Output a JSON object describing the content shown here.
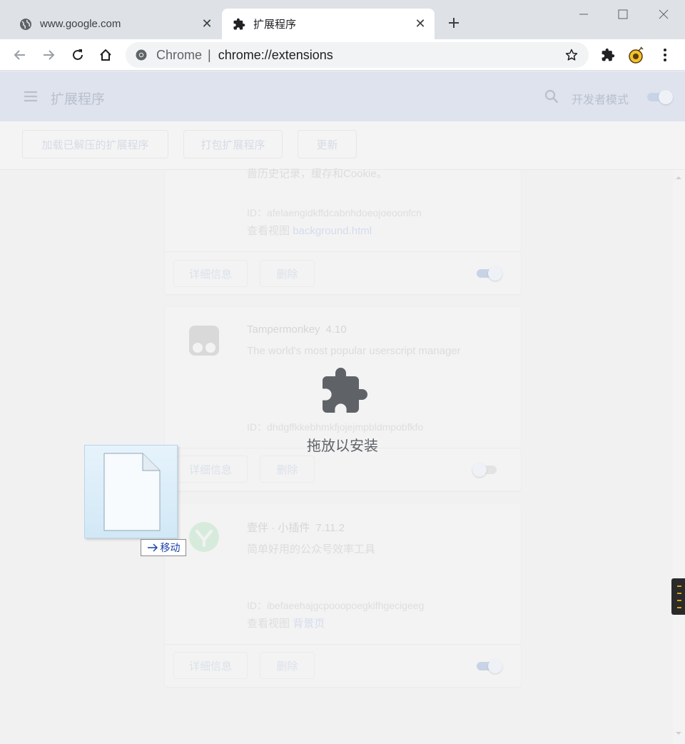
{
  "tabs": [
    {
      "title": "www.google.com",
      "favicon": "globe-icon",
      "active": false
    },
    {
      "title": "扩展程序",
      "favicon": "puzzle-icon",
      "active": true
    }
  ],
  "omnibox": {
    "scheme": "Chrome",
    "separator": "|",
    "url": "chrome://extensions"
  },
  "header": {
    "title": "扩展程序",
    "dev_mode_label": "开发者模式",
    "dev_mode_on": true
  },
  "toolbar_buttons": {
    "load_unpacked": "加载已解压的扩展程序",
    "pack": "打包扩展程序",
    "update": "更新"
  },
  "cards": [
    {
      "desc_tail": "啬历史记录，缓存和Cookie。",
      "id_label": "ID：",
      "id": "afelaengidkffdcabnhdoeojoeoonfcn",
      "views_label": "查看视图",
      "view_link": "background.html",
      "details_label": "详细信息",
      "remove_label": "删除",
      "enabled": true
    },
    {
      "name": "Tampermonkey",
      "version": "4.10",
      "desc": "The world's most popular userscript manager",
      "id_label": "ID：",
      "id": "dhdgffkkebhmkfjojejmpbldmpobfkfo",
      "details_label": "详细信息",
      "remove_label": "删除",
      "enabled": false
    },
    {
      "name": "壹伴 · 小插件",
      "version": "7.11.2",
      "desc": "简单好用的公众号效率工具",
      "id_label": "ID：",
      "id": "ibefaeehajgcpooopoegkifhgecigeeg",
      "views_label": "查看视图",
      "view_link": "背景页",
      "details_label": "详细信息",
      "remove_label": "删除",
      "enabled": true
    }
  ],
  "drop_overlay": {
    "label": "拖放以安装",
    "icon": "puzzle-icon"
  },
  "drag_ghost": {
    "badge": "移动",
    "icon": "file-icon"
  },
  "colors": {
    "accent": "#1a73e8",
    "overlay_icon": "#5f6368",
    "tabstrip": "#dee1e6"
  }
}
